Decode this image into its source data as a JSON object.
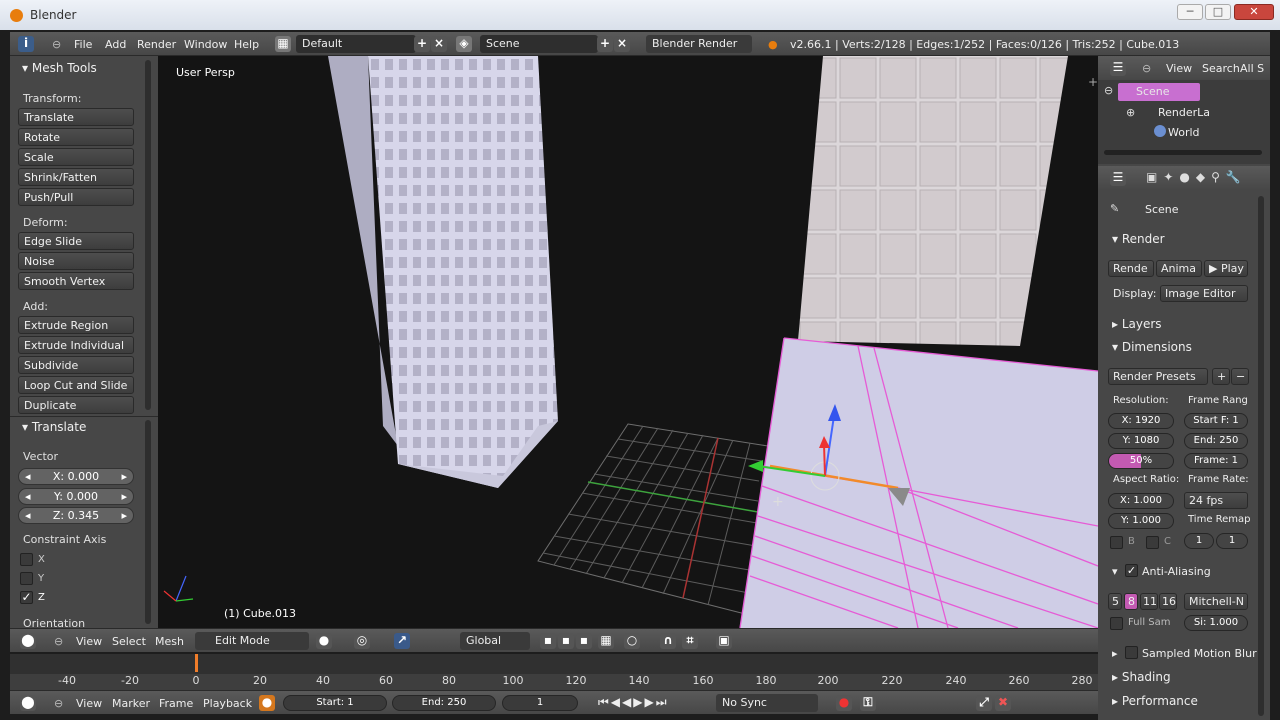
{
  "window": {
    "title": "Blender",
    "minimize": "─",
    "maximize": "□",
    "close": "✕"
  },
  "topbar": {
    "menus": [
      "File",
      "Add",
      "Render",
      "Window",
      "Help"
    ],
    "layout": "Default",
    "scene": "Scene",
    "engine": "Blender Render",
    "stats": "v2.66.1 | Verts:2/128 | Edges:1/252 | Faces:0/126 | Tris:252 | Cube.013"
  },
  "toolshelf": {
    "title": "Mesh Tools",
    "transform_label": "Transform:",
    "transform": [
      "Translate",
      "Rotate",
      "Scale",
      "Shrink/Fatten",
      "Push/Pull"
    ],
    "deform_label": "Deform:",
    "deform": [
      "Edge Slide",
      "Noise",
      "Smooth Vertex"
    ],
    "add_label": "Add:",
    "add": [
      "Extrude Region",
      "Extrude Individual",
      "Subdivide",
      "Loop Cut and Slide",
      "Duplicate"
    ]
  },
  "operator": {
    "title": "Translate",
    "vector_label": "Vector",
    "x": "X: 0.000",
    "y": "Y: 0.000",
    "z": "Z: 0.345",
    "constraint_label": "Constraint Axis",
    "axes": [
      {
        "label": "X",
        "checked": false
      },
      {
        "label": "Y",
        "checked": false
      },
      {
        "label": "Z",
        "checked": true
      }
    ],
    "orientation": "Orientation"
  },
  "viewport": {
    "view_name": "User Persp",
    "object_label": "(1) Cube.013"
  },
  "header3d": {
    "menus": [
      "View",
      "Select",
      "Mesh"
    ],
    "mode": "Edit Mode",
    "orientation": "Global"
  },
  "timeline": {
    "ticks": [
      "-40",
      "-20",
      "0",
      "20",
      "40",
      "60",
      "80",
      "100",
      "120",
      "140",
      "160",
      "180",
      "200",
      "220",
      "240",
      "260",
      "280"
    ],
    "current_frame": 0
  },
  "timeline_header": {
    "menus": [
      "View",
      "Marker",
      "Frame",
      "Playback"
    ],
    "start": "Start: 1",
    "end": "End: 250",
    "frame": "1",
    "sync": "No Sync"
  },
  "outliner": {
    "view": "View",
    "search": "Search",
    "all": "All S",
    "items": [
      "Scene",
      "RenderLa",
      "World"
    ]
  },
  "properties": {
    "context": "Scene",
    "render_title": "Render",
    "render_btn": "Rende",
    "anim_btn": "Anima",
    "play_btn": "Play",
    "display_label": "Display:",
    "display_value": "Image Editor",
    "layers": "Layers",
    "dimensions": "Dimensions",
    "presets": "Render Presets",
    "resolution_label": "Resolution:",
    "frame_range_label": "Frame Rang",
    "res_x": "X: 1920",
    "res_y": "Y: 1080",
    "res_pct": "50%",
    "start_f": "Start F: 1",
    "end_f": "End: 250",
    "frame_step": "Frame: 1",
    "aspect_label": "Aspect Ratio:",
    "framerate_label": "Frame Rate:",
    "asp_x": "X: 1.000",
    "asp_y": "Y: 1.000",
    "fps": "24 fps",
    "time_remap": "Time Remap",
    "b": "B",
    "c": "C",
    "remap_a": "1",
    "remap_b": "1",
    "aa_label": "Anti-Aliasing",
    "aa_samples": [
      "5",
      "8",
      "11",
      "16"
    ],
    "aa_filter": "Mitchell-N",
    "full_sample": "Full Sam",
    "filter_size": "Si: 1.000",
    "motion_blur": "Sampled Motion Blur",
    "shading": "Shading",
    "performance": "Performance"
  }
}
